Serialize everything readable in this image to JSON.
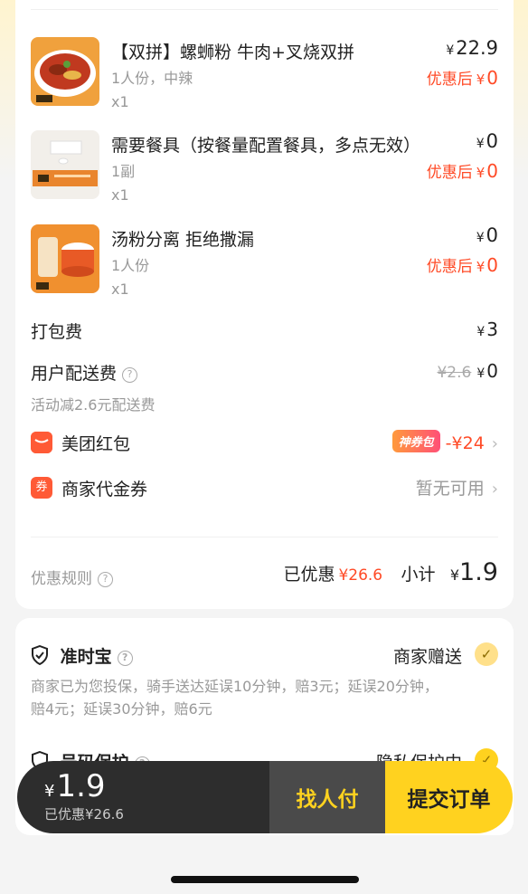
{
  "items": [
    {
      "name": "【双拼】螺蛳粉 牛肉+叉烧双拼",
      "spec": "1人份，中辣",
      "qty": "x1",
      "price": "22.9",
      "after_label": "优惠后",
      "after_price": "0"
    },
    {
      "name": "需要餐具（按餐量配置餐具，多点无效）",
      "spec": "1副",
      "qty": "x1",
      "price": "0",
      "after_label": "优惠后",
      "after_price": "0"
    },
    {
      "name": "汤粉分离 拒绝撒漏",
      "spec": "1人份",
      "qty": "x1",
      "price": "0",
      "after_label": "优惠后",
      "after_price": "0"
    }
  ],
  "currency": "¥",
  "packing": {
    "label": "打包费",
    "value": "3"
  },
  "delivery": {
    "label": "用户配送费",
    "original": "¥2.6",
    "value": "0",
    "note": "活动减2.6元配送费"
  },
  "red_packet": {
    "icon_char": "",
    "label": "美团红包",
    "badge": "神券包",
    "amount": "-¥24"
  },
  "merchant_coupon": {
    "icon_char": "券",
    "label": "商家代金券",
    "value": "暂无可用"
  },
  "summary": {
    "rules_label": "优惠规则",
    "saved_label": "已优惠",
    "saved_amount": "¥26.6",
    "subtotal_label": "小计",
    "subtotal": "1.9"
  },
  "on_time": {
    "title": "准时宝",
    "status": "商家赠送",
    "desc_line1": "商家已为您投保，骑手送达延误10分钟，赔3元；延误20分钟，",
    "desc_line2": "赔4元；延误30分钟，赔6元"
  },
  "number_protect": {
    "title": "号码保护",
    "status": "隐私保护中"
  },
  "bottom_bar": {
    "total": "1.9",
    "saved": "已优惠¥26.6",
    "pay_by_other": "找人付",
    "submit": "提交订单"
  },
  "colors": {
    "accent_yellow": "#ffd21f",
    "discount_red": "#ff4a26",
    "dark_bar": "#2d2d2d"
  }
}
